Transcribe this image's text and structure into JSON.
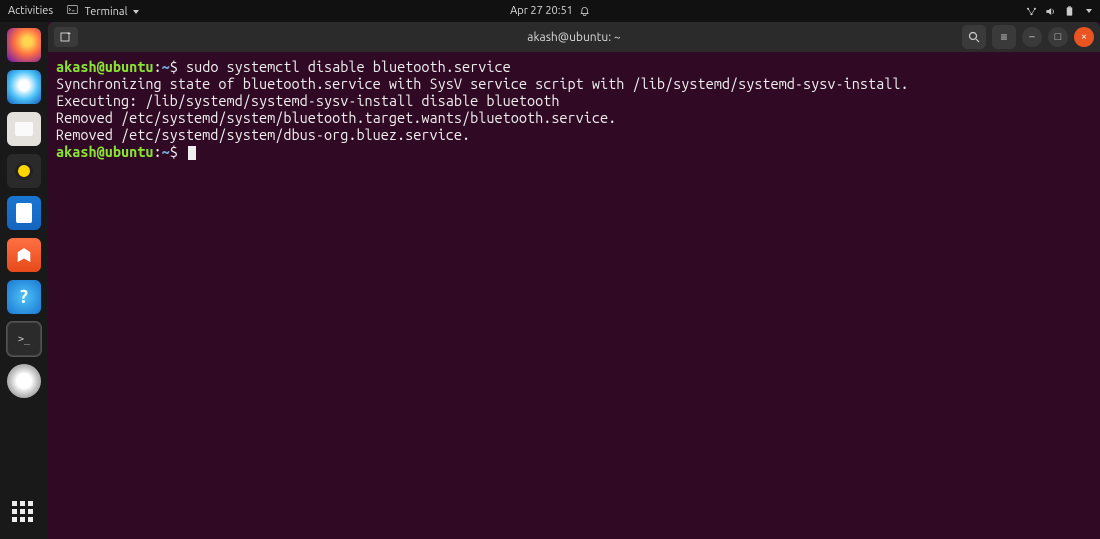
{
  "topbar": {
    "activities": "Activities",
    "app_menu": "Terminal",
    "clock": "Apr 27  20:51"
  },
  "dock": {
    "items": [
      {
        "name": "firefox",
        "label": "Firefox"
      },
      {
        "name": "thunderbird",
        "label": "Thunderbird"
      },
      {
        "name": "files",
        "label": "Files"
      },
      {
        "name": "rhythmbox",
        "label": "Rhythmbox"
      },
      {
        "name": "writer",
        "label": "LibreOffice Writer"
      },
      {
        "name": "software",
        "label": "Ubuntu Software"
      },
      {
        "name": "help",
        "label": "Help"
      },
      {
        "name": "terminal",
        "label": "Terminal"
      },
      {
        "name": "disc",
        "label": "Disc"
      }
    ]
  },
  "window": {
    "title": "akash@ubuntu: ~",
    "buttons": {
      "search": "Q",
      "menu": "≡",
      "min": "–",
      "max": "□",
      "close": "×"
    }
  },
  "terminal": {
    "prompt": {
      "user": "akash@ubuntu",
      "sep": ":",
      "path": "~",
      "sym": "$"
    },
    "lines": [
      {
        "type": "cmd",
        "text": "sudo systemctl disable bluetooth.service"
      },
      {
        "type": "out",
        "text": "Synchronizing state of bluetooth.service with SysV service script with /lib/systemd/systemd-sysv-install."
      },
      {
        "type": "out",
        "text": "Executing: /lib/systemd/systemd-sysv-install disable bluetooth"
      },
      {
        "type": "out",
        "text": "Removed /etc/systemd/system/bluetooth.target.wants/bluetooth.service."
      },
      {
        "type": "out",
        "text": "Removed /etc/systemd/system/dbus-org.bluez.service."
      },
      {
        "type": "prompt"
      }
    ]
  }
}
